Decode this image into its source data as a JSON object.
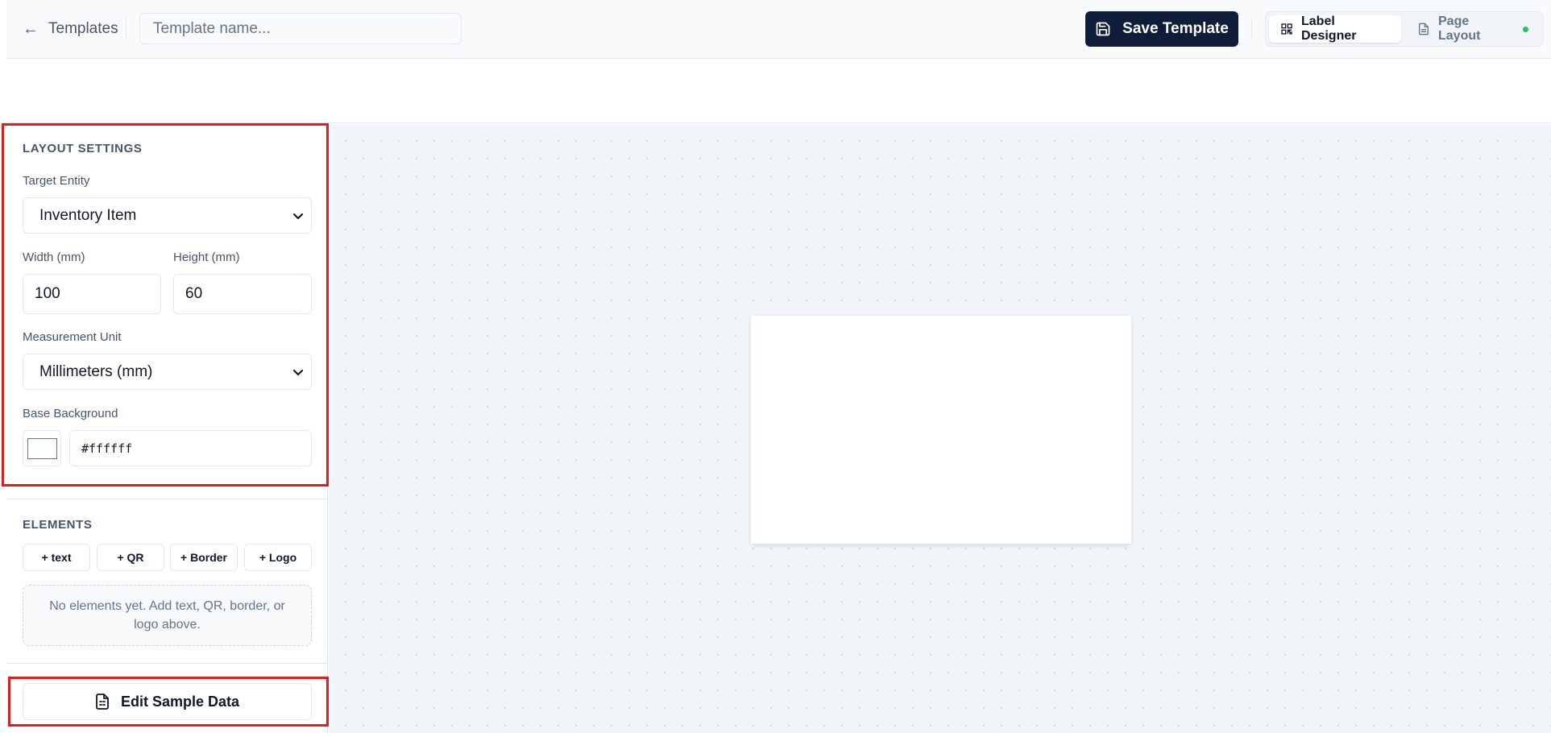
{
  "header": {
    "back_label": "Templates",
    "template_name_placeholder": "Template name...",
    "template_name_value": "",
    "save_label": "Save Template",
    "modes": [
      {
        "label": "Label Designer",
        "icon": "qr-code-icon",
        "active": true
      },
      {
        "label": "Page Layout",
        "icon": "file-text-icon",
        "active": false,
        "status_color": "#22c55e"
      }
    ]
  },
  "sidebar": {
    "layout_settings": {
      "title": "LAYOUT SETTINGS",
      "target_entity_label": "Target Entity",
      "target_entity_value": "Inventory Item",
      "width_label": "Width (mm)",
      "width_value": "100",
      "height_label": "Height (mm)",
      "height_value": "60",
      "unit_label": "Measurement Unit",
      "unit_value": "Millimeters (mm)",
      "background_label": "Base Background",
      "background_value": "#ffffff"
    },
    "elements": {
      "title": "ELEMENTS",
      "add_buttons": [
        "+ text",
        "+ QR",
        "+ Border",
        "+ Logo"
      ],
      "empty_message": "No elements yet. Add text, QR, border, or logo above."
    },
    "sample_data_label": "Edit Sample Data"
  },
  "colors": {
    "primary": "#0f1d3a",
    "highlight": "#e01e1e",
    "canvas_bg": "#f1f5f9",
    "status_dot": "#22c55e"
  }
}
